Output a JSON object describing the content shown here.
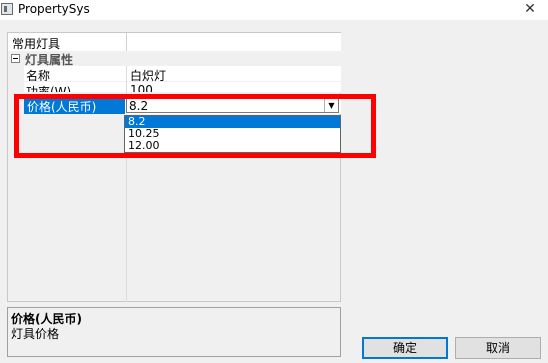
{
  "window": {
    "title": "PropertySys",
    "close_glyph": "✕"
  },
  "grid": {
    "tab_label": "常用灯具",
    "category": {
      "label": "灯具属性",
      "expanded": true
    },
    "properties": [
      {
        "name": "名称",
        "value": "白炽灯"
      },
      {
        "name": "功率(W)",
        "value": "100"
      }
    ],
    "selected_property": {
      "name": "价格(人民币)",
      "value": "8.2",
      "options": [
        "8.2",
        "10.25",
        "12.00"
      ],
      "selected_option": "8.2"
    }
  },
  "description": {
    "title": "价格(人民币)",
    "text": "灯具价格"
  },
  "buttons": {
    "ok": "确定",
    "cancel": "取消"
  },
  "colors": {
    "selection": "#0078d7",
    "highlight_box": "#ff0000"
  }
}
